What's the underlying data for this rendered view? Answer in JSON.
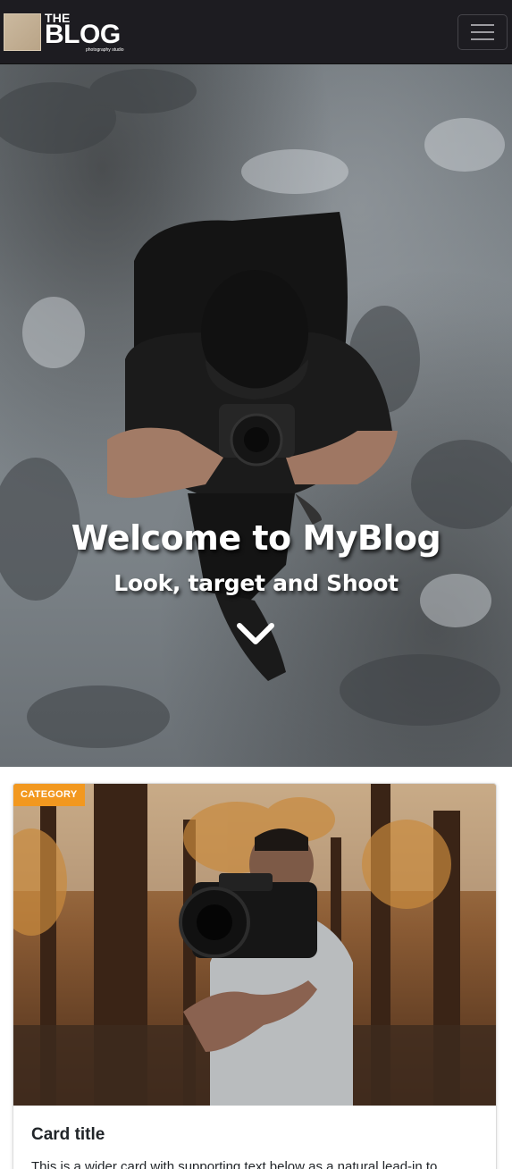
{
  "navbar": {
    "brand_the": "THE",
    "brand_blog": "BLOG",
    "brand_sub": "photography studio",
    "toggler_icon": "hamburger-icon"
  },
  "hero": {
    "title": "Welcome to MyBlog",
    "subtitle": "Look, target and Shoot",
    "scroll_icon": "chevron-down-icon"
  },
  "card": {
    "badge": "CATEGORY",
    "title": "Card title",
    "text": "This is a wider card with supporting text below as a natural lead-in to"
  },
  "colors": {
    "navbar_bg": "#1d1c21",
    "badge_bg": "#f2981f",
    "text": "#212529"
  }
}
